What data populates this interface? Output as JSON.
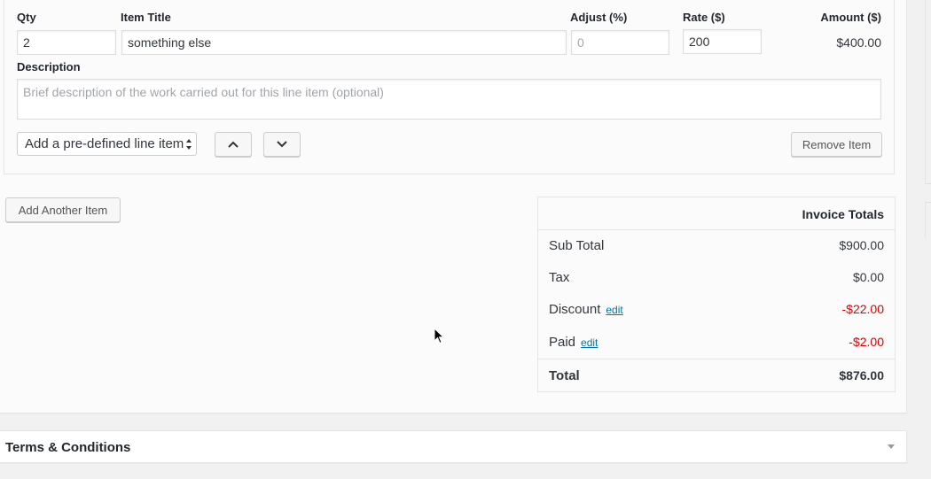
{
  "line_item": {
    "labels": {
      "qty": "Qty",
      "title": "Item Title",
      "adjust": "Adjust (%)",
      "rate": "Rate ($)",
      "amount": "Amount ($)",
      "description": "Description"
    },
    "qty_value": "2",
    "title_value": "something else",
    "adjust_placeholder": "0",
    "rate_value": "200",
    "amount_value": "$400.00",
    "description_placeholder": "Brief description of the work carried out for this line item (optional)",
    "predefined_select": "Add a pre-defined line item",
    "move_up_icon": "chevron-up-icon",
    "move_down_icon": "chevron-down-icon",
    "remove_label": "Remove Item"
  },
  "add_item_label": "Add Another Item",
  "totals": {
    "heading": "Invoice Totals",
    "rows": [
      {
        "label": "Sub Total",
        "value": "$900.00"
      },
      {
        "label": "Tax",
        "value": "$0.00"
      },
      {
        "label": "Discount",
        "edit": "edit",
        "value": "-$22.00"
      },
      {
        "label": "Paid",
        "edit": "edit",
        "value": "-$2.00"
      }
    ],
    "total_label": "Total",
    "total_value": "$876.00"
  },
  "terms": {
    "title": "Terms & Conditions"
  },
  "colors": {
    "negative": "#dd0000",
    "link": "#0073aa"
  }
}
